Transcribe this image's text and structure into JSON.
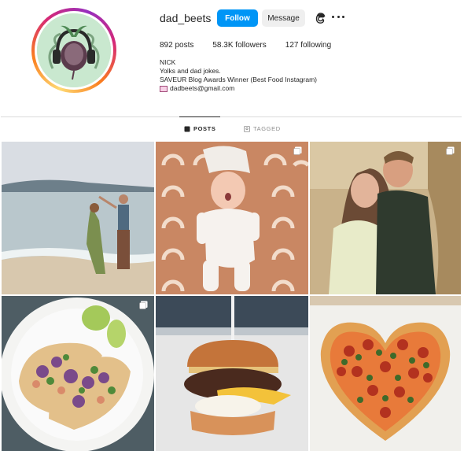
{
  "profile": {
    "username": "dad_beets",
    "follow_label": "Follow",
    "message_label": "Message",
    "stats": {
      "posts": "892",
      "posts_label": "posts",
      "followers": "58.3K",
      "followers_label": "followers",
      "following": "127",
      "following_label": "following"
    },
    "bio": {
      "name": "NICK",
      "line1": "Yolks and dad jokes.",
      "line2": "SAVEUR Blog Awards Winner (Best Food Instagram)",
      "email": "dadbeets@gmail.com"
    }
  },
  "tabs": {
    "posts": "POSTS",
    "tagged": "TAGGED"
  },
  "icons": [
    "threads-icon",
    "more-options-icon",
    "grid-icon",
    "tagged-icon",
    "envelope-icon",
    "carousel-icon"
  ],
  "colors": {
    "follow_button": "#0095f6",
    "message_button": "#efefef",
    "text": "#262626",
    "muted": "#8e8e8e"
  }
}
